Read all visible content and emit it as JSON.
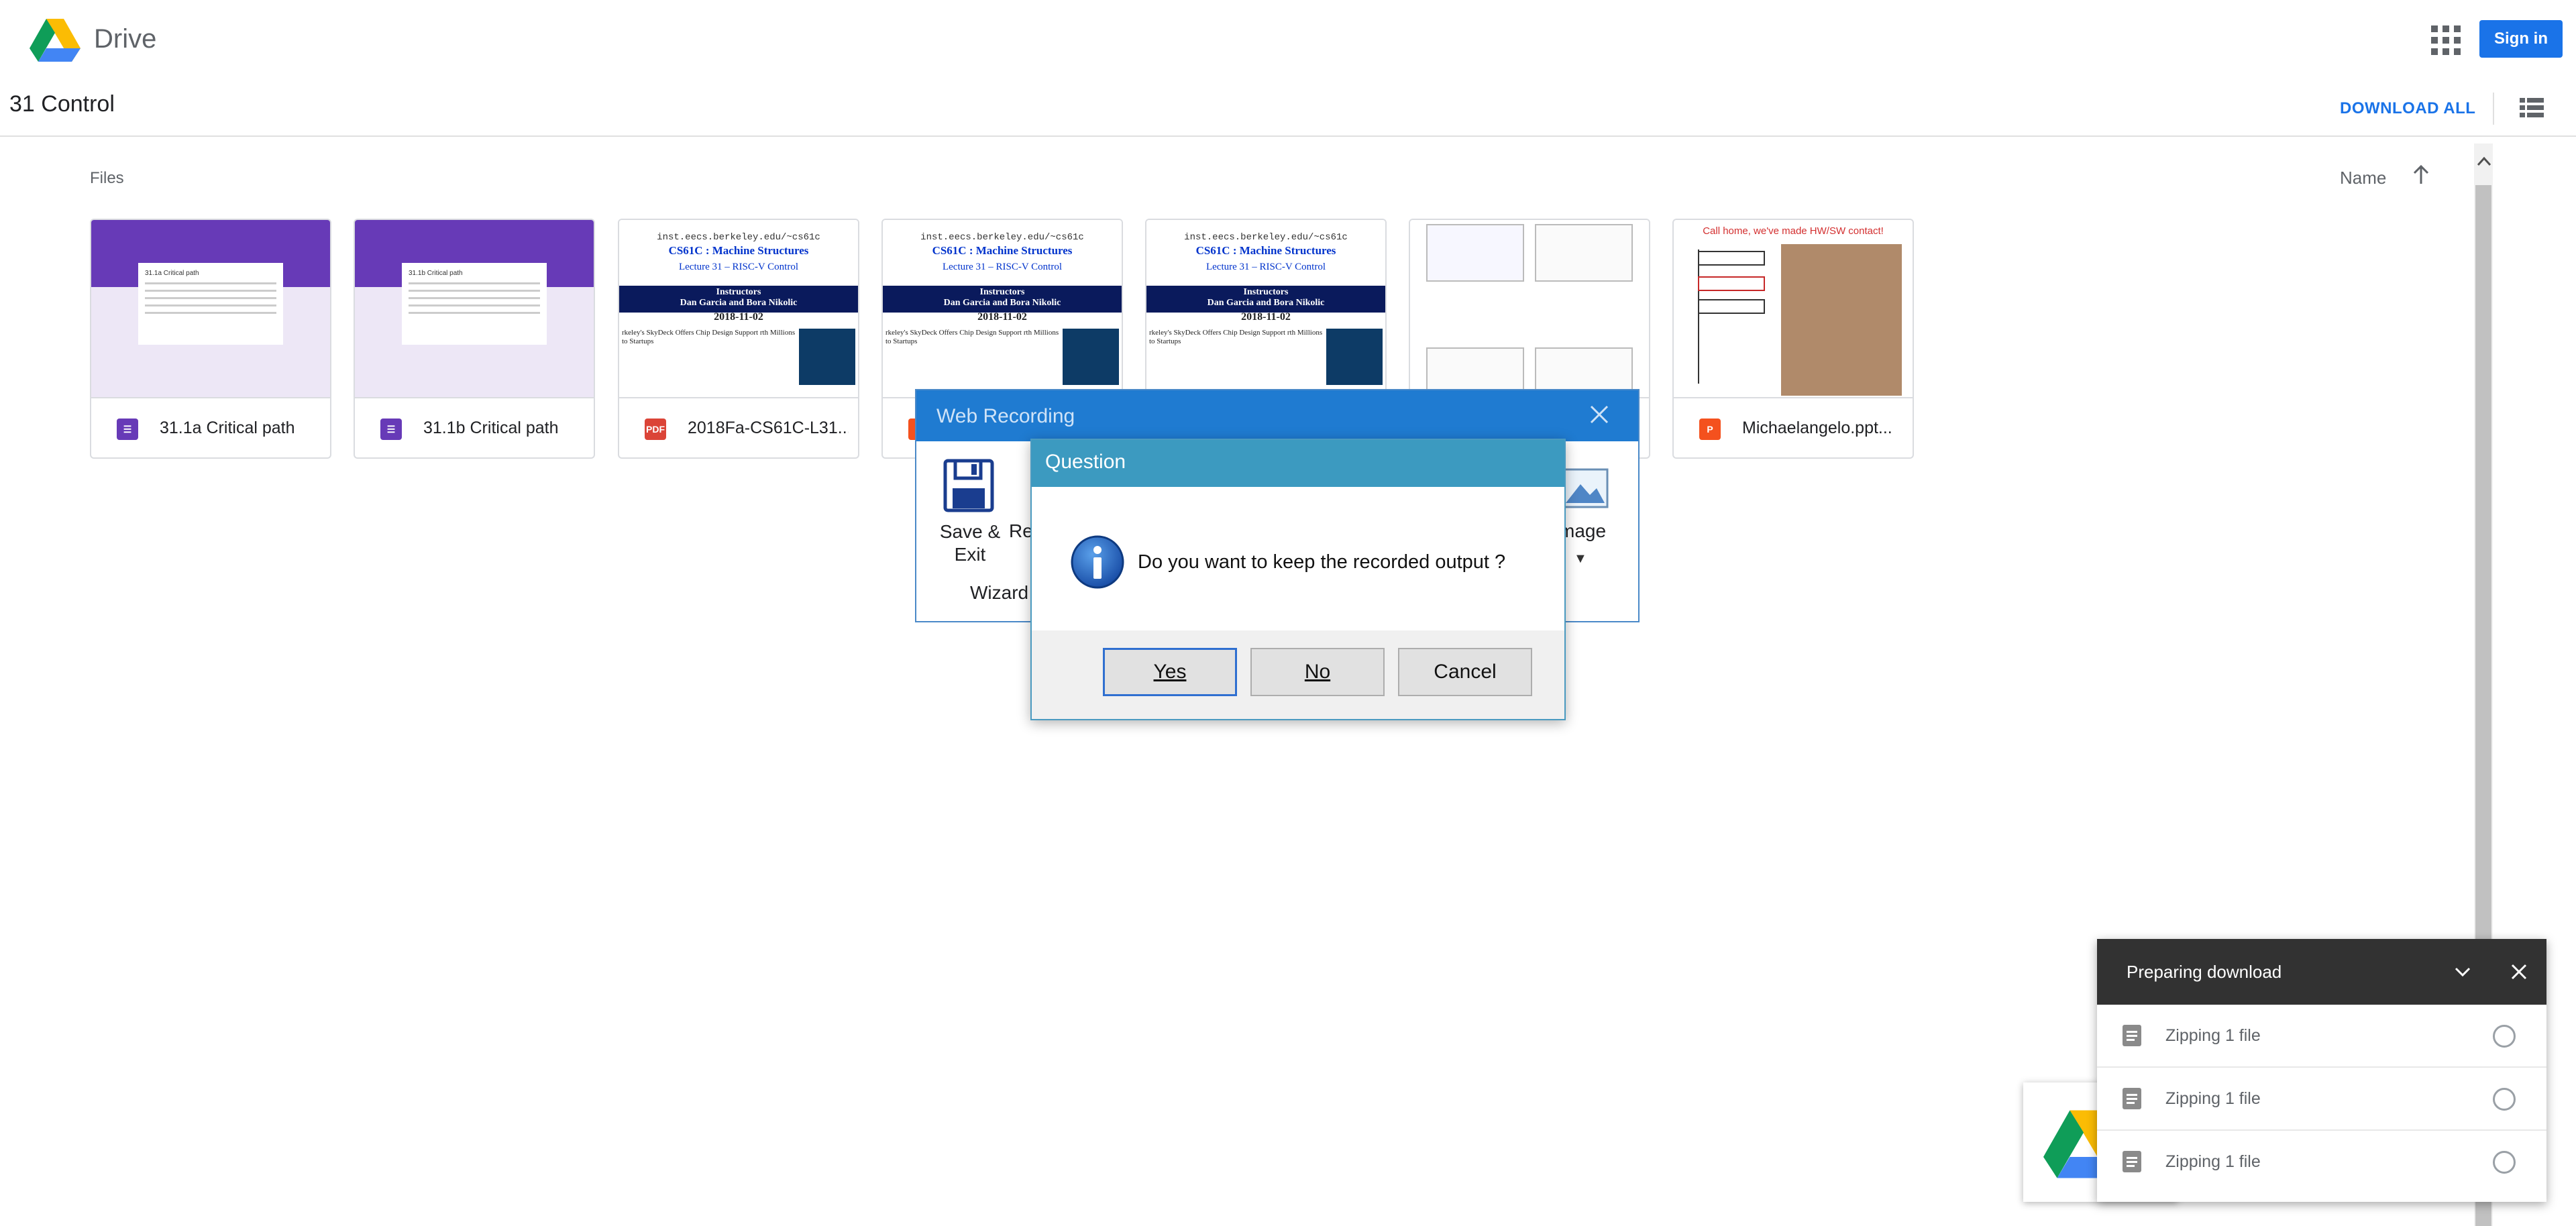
{
  "app": {
    "brand": "Drive",
    "sign_in": "Sign in"
  },
  "folder": {
    "title": "31 Control",
    "download_all": "DOWNLOAD ALL"
  },
  "files": {
    "section_label": "Files",
    "sort_label": "Name",
    "items": [
      {
        "name": "31.1a Critical path",
        "type": "form",
        "thumb_title": "31.1a Critical path"
      },
      {
        "name": "31.1b Critical path",
        "type": "form",
        "thumb_title": "31.1b Critical path"
      },
      {
        "name": "2018Fa-CS61C-L31...",
        "type": "pdf",
        "icon_text": "PDF"
      },
      {
        "name": "",
        "type": "slides"
      },
      {
        "name": "",
        "type": "slides"
      },
      {
        "name": "",
        "type": "slides"
      },
      {
        "name": "Michaelangelo.ppt...",
        "type": "pptx",
        "icon_text": "P",
        "thumb_title": "Call home, we've made HW/SW contact!"
      }
    ],
    "slide_thumb": {
      "url": "inst.eecs.berkeley.edu/~cs61c",
      "course": "CS61C : Machine Structures",
      "lecture": "Lecture 31 – RISC-V Control",
      "instructors_label": "Instructors",
      "instructors": "Dan Garcia and Bora Nikolic",
      "date": "2018-11-02",
      "headline": "rkeley's SkyDeck Offers Chip Design Support rth Millions to Startups"
    }
  },
  "web_recording": {
    "title": "Web Recording",
    "save_exit": "Save & Exit",
    "re_label": "Re",
    "wizard": "Wizard",
    "image": "mage"
  },
  "question_dialog": {
    "title": "Question",
    "message": "Do you want to keep the recorded output ?",
    "buttons": {
      "yes": "Yes",
      "no": "No",
      "cancel": "Cancel"
    }
  },
  "download_panel": {
    "title": "Preparing download",
    "rows": [
      {
        "label": "Zipping 1 file"
      },
      {
        "label": "Zipping 1 file"
      },
      {
        "label": "Zipping 1 file"
      }
    ]
  },
  "colors": {
    "accent": "#1a73e8",
    "form_purple": "#673ab7",
    "pdf_red": "#db4437",
    "ppt_orange": "#f4511e",
    "dialog_blue": "#1f7bd1"
  }
}
